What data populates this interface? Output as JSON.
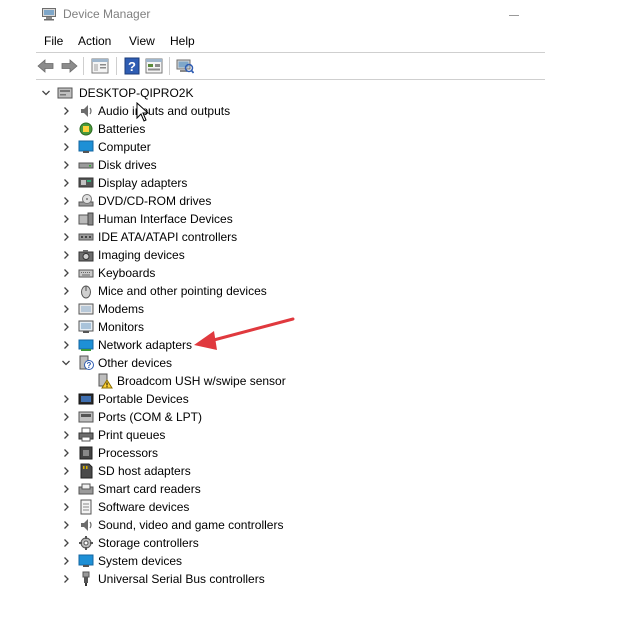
{
  "window": {
    "title": "Device Manager",
    "icon": "device-manager-icon"
  },
  "menu": {
    "file": "File",
    "action": "Action",
    "view": "View",
    "help": "Help"
  },
  "toolbar": {
    "buttons": [
      "back-arrow-icon",
      "forward-arrow-icon",
      "properties-icon",
      "help-icon",
      "view-toggle-icon",
      "scan-hardware-icon"
    ]
  },
  "tree": {
    "root": {
      "label": "DESKTOP-QIPRO2K",
      "icon": "computer-tree-root-icon",
      "expanded": true
    },
    "categories": [
      {
        "label": "Audio inputs and outputs",
        "icon": "speaker-icon"
      },
      {
        "label": "Batteries",
        "icon": "battery-icon"
      },
      {
        "label": "Computer",
        "icon": "monitor-icon"
      },
      {
        "label": "Disk drives",
        "icon": "disk-drive-icon"
      },
      {
        "label": "Display adapters",
        "icon": "display-adapter-icon"
      },
      {
        "label": "DVD/CD-ROM drives",
        "icon": "dvd-drive-icon"
      },
      {
        "label": "Human Interface Devices",
        "icon": "hid-icon"
      },
      {
        "label": "IDE ATA/ATAPI controllers",
        "icon": "ide-controller-icon"
      },
      {
        "label": "Imaging devices",
        "icon": "camera-icon"
      },
      {
        "label": "Keyboards",
        "icon": "keyboard-icon"
      },
      {
        "label": "Mice and other pointing devices",
        "icon": "mouse-icon"
      },
      {
        "label": "Modems",
        "icon": "modem-icon"
      },
      {
        "label": "Monitors",
        "icon": "monitor-icon"
      },
      {
        "label": "Network adapters",
        "icon": "network-adapter-icon"
      },
      {
        "label": "Other devices",
        "icon": "unknown-device-icon",
        "expanded": true,
        "children": [
          {
            "label": "Broadcom USH w/swipe sensor",
            "icon": "warning-device-icon"
          }
        ]
      },
      {
        "label": "Portable Devices",
        "icon": "portable-device-icon"
      },
      {
        "label": "Ports (COM & LPT)",
        "icon": "port-icon"
      },
      {
        "label": "Print queues",
        "icon": "printer-icon"
      },
      {
        "label": "Processors",
        "icon": "processor-icon"
      },
      {
        "label": "SD host adapters",
        "icon": "sd-card-icon"
      },
      {
        "label": "Smart card readers",
        "icon": "smart-card-icon"
      },
      {
        "label": "Software devices",
        "icon": "software-device-icon"
      },
      {
        "label": "Sound, video and game controllers",
        "icon": "speaker-icon"
      },
      {
        "label": "Storage controllers",
        "icon": "storage-controller-icon"
      },
      {
        "label": "System devices",
        "icon": "monitor-icon"
      },
      {
        "label": "Universal Serial Bus controllers",
        "icon": "usb-icon"
      }
    ]
  },
  "colors": {
    "annotation_arrow": "#e0393e",
    "selection_monitor_blue": "#1e90d6"
  }
}
